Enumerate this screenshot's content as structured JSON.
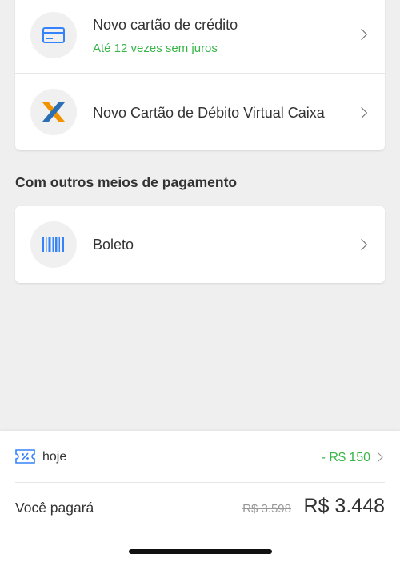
{
  "payment_cards": {
    "new_credit_card": {
      "title": "Novo cartão de crédito",
      "subtitle": "Até 12 vezes sem juros",
      "icon": "credit-card-icon"
    },
    "caixa_debit": {
      "title": "Novo Cartão de Débito Virtual Caixa",
      "icon": "caixa-logo-icon"
    }
  },
  "other_methods": {
    "section_title": "Com outros meios de pagamento",
    "boleto": {
      "title": "Boleto",
      "icon": "barcode-icon"
    }
  },
  "footer": {
    "coupon_label": "hoje",
    "coupon_icon": "coupon-icon",
    "discount": "- R$ 150",
    "pay_label": "Você pagará",
    "old_price": "R$ 3.598",
    "new_price": "R$ 3.448"
  },
  "colors": {
    "accent_green": "#39b54a",
    "icon_blue": "#3483fa",
    "caixa_orange": "#f39200",
    "background": "#efefef"
  }
}
